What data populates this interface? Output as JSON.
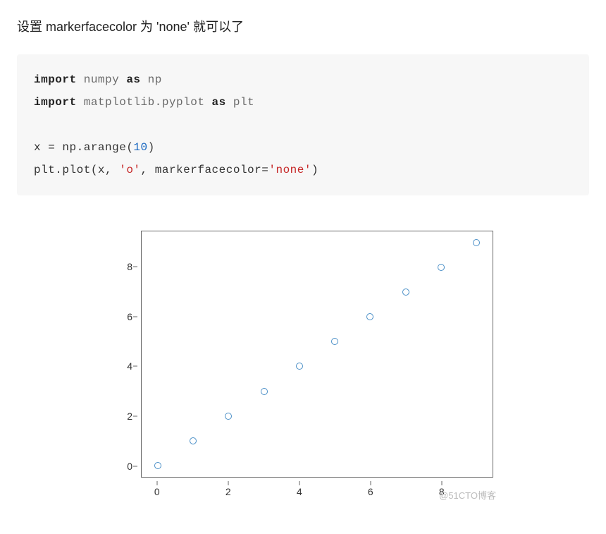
{
  "intro": "设置 markerfacecolor 为 'none' 就可以了",
  "code": {
    "l1_kw1": "import",
    "l1_mod": " numpy ",
    "l1_kw2": "as",
    "l1_alias": " np",
    "l2_kw1": "import",
    "l2_mod": " matplotlib.pyplot ",
    "l2_kw2": "as",
    "l2_alias": " plt",
    "l3_pre": "x = np.arange(",
    "l3_num": "10",
    "l3_post": ")",
    "l4_pre": "plt.plot(x, ",
    "l4_str1": "'o'",
    "l4_mid": ", markerfacecolor=",
    "l4_str2": "'none'",
    "l4_post": ")"
  },
  "chart_data": {
    "type": "scatter",
    "x": [
      0,
      1,
      2,
      3,
      4,
      5,
      6,
      7,
      8,
      9
    ],
    "y": [
      0,
      1,
      2,
      3,
      4,
      5,
      6,
      7,
      8,
      9
    ],
    "xlim": [
      -0.45,
      9.45
    ],
    "ylim": [
      -0.45,
      9.45
    ],
    "xticks": [
      0,
      2,
      4,
      6,
      8
    ],
    "yticks": [
      0,
      2,
      4,
      6,
      8
    ],
    "marker": "o",
    "markerfacecolor": "none",
    "markeredgecolor": "#4a8fc7"
  },
  "watermark": "@51CTO博客"
}
